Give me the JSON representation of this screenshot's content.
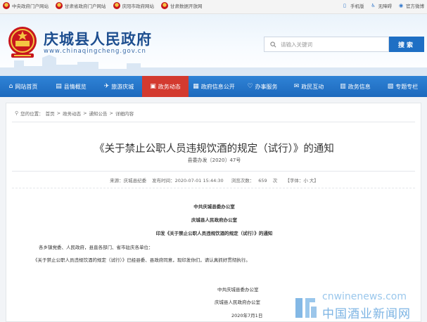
{
  "topbar": {
    "links": [
      "中央政府门户网站",
      "甘肃省政府门户网站",
      "庆阳市政府网站",
      "甘肃数据开放网"
    ],
    "right": [
      {
        "icon": "mobile-icon",
        "label": "手机版"
      },
      {
        "icon": "accessibility-icon",
        "label": "无障碍"
      },
      {
        "icon": "weibo-icon",
        "label": "官方微博"
      }
    ]
  },
  "header": {
    "title": "庆城县人民政府",
    "url": "www.chinaqingcheng.gov.cn",
    "search_placeholder": "请输入关键词",
    "search_button": "搜索"
  },
  "nav": {
    "items": [
      {
        "icon": "home-icon",
        "label": "网站首页",
        "active": false
      },
      {
        "icon": "book-icon",
        "label": "县情概览",
        "active": false
      },
      {
        "icon": "travel-icon",
        "label": "旅游庆城",
        "active": false
      },
      {
        "icon": "news-icon",
        "label": "政务动态",
        "active": true
      },
      {
        "icon": "document-icon",
        "label": "政府信息公开",
        "active": false
      },
      {
        "icon": "service-icon",
        "label": "办事服务",
        "active": false
      },
      {
        "icon": "chat-icon",
        "label": "政民互动",
        "active": false
      },
      {
        "icon": "data-icon",
        "label": "政务信息",
        "active": false
      },
      {
        "icon": "topic-icon",
        "label": "专题专栏",
        "active": false
      }
    ]
  },
  "breadcrumb": {
    "prefix": "您的位置：",
    "items": [
      "首页",
      "政务动态",
      "通知公告",
      "详细内容"
    ],
    "separator": ">"
  },
  "article": {
    "title": "《关于禁止公职人员违规饮酒的规定（试行）》的通知",
    "doc_number": "县委办发〔2020〕47号",
    "meta": {
      "source": "来源：庆城县纪委",
      "date": "发布时间：2020-07-01 15:44:30",
      "views_label": "浏览次数：",
      "views": "659",
      "views_unit": "次",
      "font": "【字体：小 大】"
    },
    "body": {
      "issuer1": "中共庆城县委办公室",
      "issuer2": "庆城县人民政府办公室",
      "subject": "印发《关于禁止公职人员违规饮酒的规定（试行）》的通知",
      "salutation": "各乡镇党委、人民政府，县直各部门、省市驻庆各单位：",
      "paragraph": "《关于禁止公职人员违规饮酒的规定（试行）》已经县委、县政府同意，现印发你们，请认真抓好贯彻执行。",
      "sign1": "中共庆城县委办公室",
      "sign2": "庆城县人民政府办公室",
      "sign_date": "2020年7月1日"
    }
  },
  "watermark": {
    "en": "cnwinenews.com",
    "cn": "中国酒业新闻网"
  },
  "colors": {
    "nav_blue": "#2f83d6",
    "nav_active": "#d33a2f",
    "title_blue": "#1d4e8f",
    "search_button": "#1e6fc4"
  }
}
